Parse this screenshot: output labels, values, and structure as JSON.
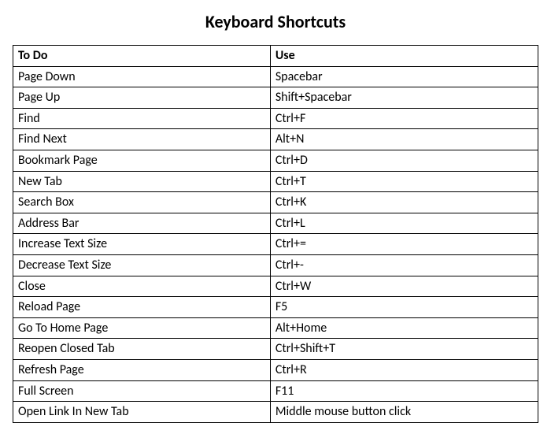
{
  "title": "Keyboard Shortcuts",
  "headers": {
    "action": "To Do",
    "use": "Use"
  },
  "rows": [
    {
      "action": "Page Down",
      "use": "Spacebar"
    },
    {
      "action": "Page Up",
      "use": "Shift+Spacebar"
    },
    {
      "action": "Find",
      "use": "Ctrl+F"
    },
    {
      "action": "Find Next",
      "use": "Alt+N"
    },
    {
      "action": "Bookmark Page",
      "use": "Ctrl+D"
    },
    {
      "action": "New Tab",
      "use": "Ctrl+T"
    },
    {
      "action": "Search Box",
      "use": "Ctrl+K"
    },
    {
      "action": "Address Bar",
      "use": "Ctrl+L"
    },
    {
      "action": "Increase Text Size",
      "use": "Ctrl+="
    },
    {
      "action": "Decrease Text Size",
      "use": "Ctrl+-"
    },
    {
      "action": "Close",
      "use": "Ctrl+W"
    },
    {
      "action": "Reload Page",
      "use": "F5"
    },
    {
      "action": "Go To Home Page",
      "use": "Alt+Home"
    },
    {
      "action": "Reopen Closed Tab",
      "use": "Ctrl+Shift+T"
    },
    {
      "action": "Refresh Page",
      "use": "Ctrl+R"
    },
    {
      "action": "Full Screen",
      "use": "F11"
    },
    {
      "action": "Open Link In New Tab",
      "use": "Middle mouse button click"
    }
  ]
}
